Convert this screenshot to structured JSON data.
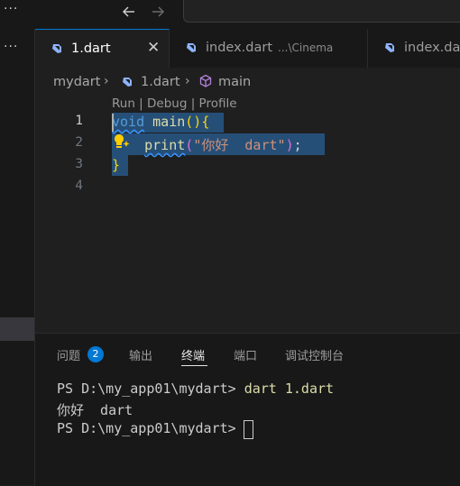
{
  "titlebar": {
    "more_icon": "ellipsis-icon",
    "back_icon": "arrow-left-icon",
    "forward_icon": "arrow-right-icon"
  },
  "sidebar": {
    "more_icon": "ellipsis-icon"
  },
  "tabs": [
    {
      "label": "1.dart",
      "description": "",
      "active": true,
      "icon": "dart-icon"
    },
    {
      "label": "index.dart",
      "description": "...\\Cinema",
      "active": false,
      "icon": "dart-icon"
    },
    {
      "label": "index.dart",
      "description": "",
      "active": false,
      "icon": "dart-icon"
    }
  ],
  "breadcrumb": {
    "folder": "mydart",
    "file": "1.dart",
    "symbol": "main"
  },
  "codelens": {
    "text": "Run | Debug | Profile"
  },
  "editor": {
    "line_numbers": [
      "1",
      "2",
      "3",
      "4"
    ],
    "lines": {
      "l1_kw": "void",
      "l1_fn": "main",
      "l1_parens": "()",
      "l1_brace": "{",
      "l2_fn": "print",
      "l2_open": "(",
      "l2_str": "\"你好  dart\"",
      "l2_close": ")",
      "l2_semi": ";",
      "l3_brace": "}"
    }
  },
  "panel": {
    "tabs": [
      "问题",
      "输出",
      "终端",
      "端口",
      "调试控制台"
    ],
    "active_tab": "终端",
    "problems_count": "2"
  },
  "terminal": {
    "prompt1": "PS D:\\my_app01\\mydart> ",
    "cmd1": "dart 1.dart",
    "output": "你好  dart",
    "prompt2": "PS D:\\my_app01\\mydart> "
  },
  "colors": {
    "accent": "#0078d4",
    "selection": "#264f78",
    "editor_bg": "#1f1f1f",
    "chrome_bg": "#181818"
  }
}
